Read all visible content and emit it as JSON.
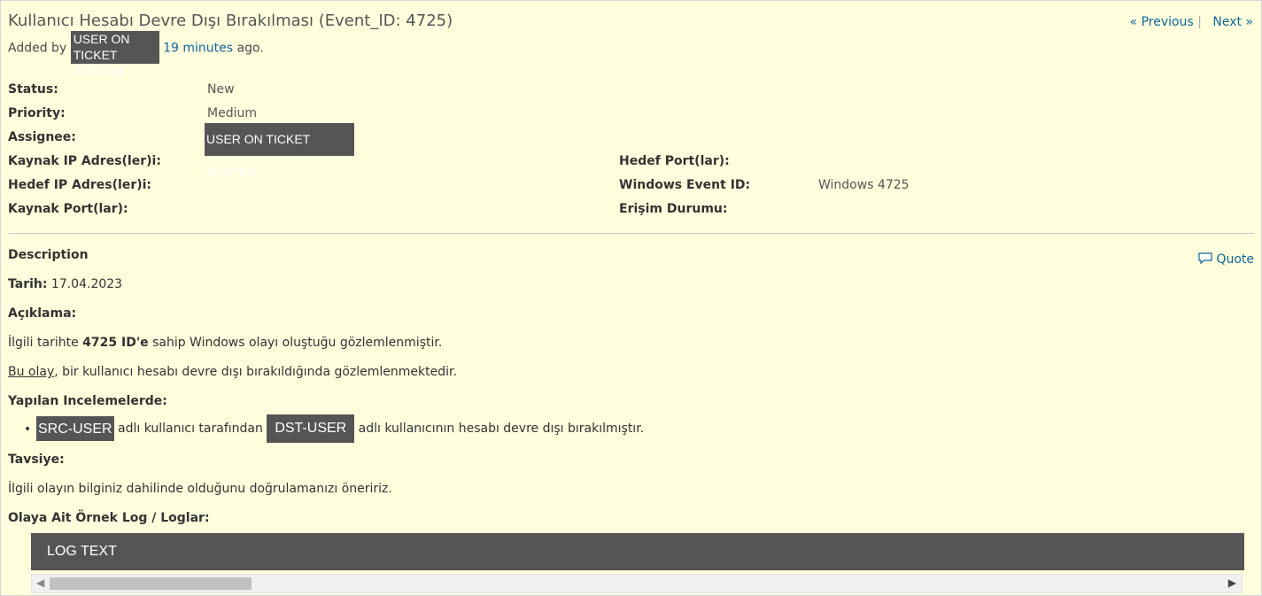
{
  "title": "Kullanıcı Hesabı Devre Dışı Bırakılması (Event_ID: 4725)",
  "pager": {
    "previous": "« Previous",
    "separator": "|",
    "next": "Next »"
  },
  "author": {
    "prefix": "Added by",
    "user_line1": "USER ON",
    "user_line2": "TICKET SYSTEM",
    "time": "19 minutes",
    "suffix": "ago."
  },
  "attributes": {
    "status_label": "Status:",
    "status": "New",
    "priority_label": "Priority:",
    "priority": "Medium",
    "assignee_label": "Assignee:",
    "assignee": "USER ON TICKET SYSTEM",
    "src_ip_label": "Kaynak IP Adres(ler)i:",
    "dst_ip_label": "Hedef IP Adres(ler)i:",
    "src_port_label": "Kaynak Port(lar):",
    "dst_port_label": "Hedef Port(lar):",
    "event_id_label": "Windows Event ID:",
    "event_id": "Windows 4725",
    "access_label": "Erişim Durumu:"
  },
  "description": {
    "heading": "Description",
    "quote": "Quote",
    "date_label": "Tarih:",
    "date": "17.04.2023",
    "explanation_label": "Açıklama:",
    "line1_pre": "İlgili tarihte ",
    "line1_bold": "4725 ID'e",
    "line1_post": " sahip Windows olayı oluştuğu gözlemlenmiştir.",
    "line2_link": "Bu olay",
    "line2_post": ", bir kullanıcı hesabı devre dışı bırakıldığında gözlemlenmektedir.",
    "findings_label": "Yapılan Incelemelerde:",
    "finding_src": "SRC-USER",
    "finding_mid": " adlı kullanıcı tarafından ",
    "finding_dst": "DST-USER",
    "finding_end": " adlı kullanıcının hesabı devre dışı bırakılmıştır.",
    "advice_label": "Tavsiye:",
    "advice": "İlgili olayın bilginiz dahilinde olduğunu doğrulamanızı öneririz.",
    "log_label": "Olaya Ait Örnek Log / Loglar:",
    "log_text": "LOG TEXT"
  }
}
